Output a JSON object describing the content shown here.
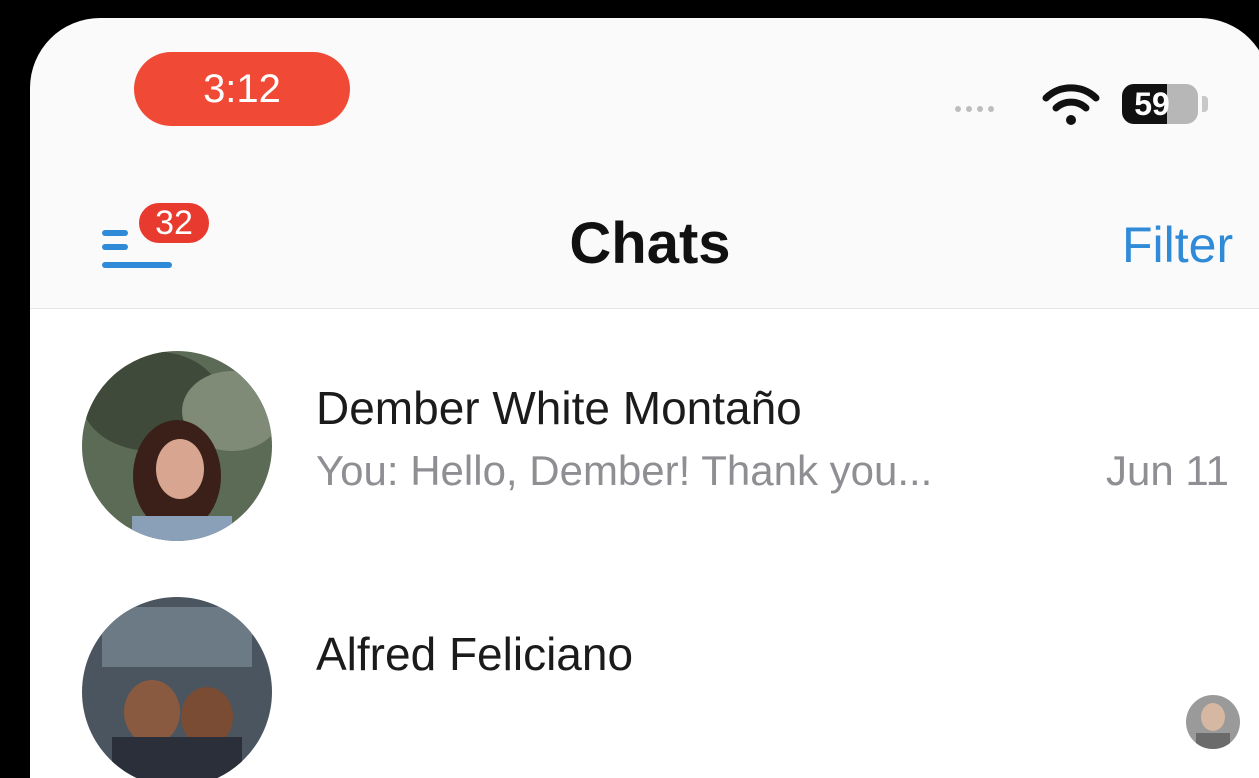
{
  "status_bar": {
    "time": "3:12",
    "battery": "59",
    "battery_level_percent": 59,
    "time_pill_color": "#f04a36"
  },
  "nav": {
    "menu_icon": "menu-icon",
    "unread_badge": "32",
    "title": "Chats",
    "filter_label": "Filter",
    "accent_color": "#2f8bd8"
  },
  "chats": [
    {
      "name": "Dember White Montaño",
      "preview": "You: Hello, Dember! Thank you...",
      "date": "Jun 11",
      "avatar_icon": "avatar-photo"
    },
    {
      "name": "Alfred Feliciano",
      "avatar_icon": "avatar-photo"
    }
  ]
}
